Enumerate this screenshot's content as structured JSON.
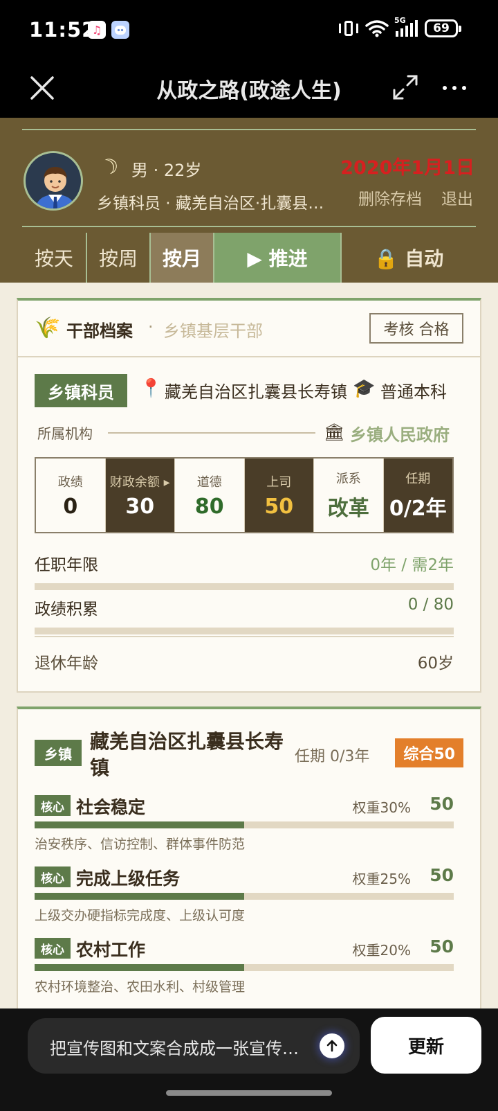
{
  "status": {
    "time": "11:52",
    "battery": "69",
    "network": "5G"
  },
  "titlebar": {
    "title": "从政之路(政途人生)"
  },
  "player": {
    "sex_age": "男 · 22岁",
    "post_location": "乡镇科员 · 藏羌自治区·扎囊县长寿镇",
    "date": "2020年1月1日",
    "delete_label": "删除存档",
    "exit_label": "退出"
  },
  "tabs": {
    "day": "按天",
    "week": "按周",
    "month": "按月",
    "advance": "▶ 推进",
    "auto": "🔒 自动",
    "selected": "month"
  },
  "profile": {
    "title": "干部档案",
    "dot": "·",
    "subtitle": "乡镇基层干部",
    "assessment": "考核 合格",
    "rank": "乡镇科员",
    "location": "藏羌自治区扎囊县长寿镇",
    "education": "普通本科",
    "org_label": "所属机构",
    "org_name": "乡镇人民政府",
    "stats": [
      {
        "label": "政绩",
        "value": "0",
        "color": "#2a2214",
        "dark": false
      },
      {
        "label": "财政余额 ▸",
        "value": "30",
        "color": "#ffffff",
        "dark": true
      },
      {
        "label": "道德",
        "value": "80",
        "color": "#2f6b2a",
        "dark": false
      },
      {
        "label": "上司",
        "value": "50",
        "color": "#f2c040",
        "dark": true
      },
      {
        "label": "派系",
        "value": "改革",
        "color": "#4d6e3c",
        "dark": false
      },
      {
        "label": "任期",
        "value": "0/2年",
        "color": "#ffffff",
        "dark": true
      }
    ],
    "tenure_label": "任职年限",
    "tenure_value": "0年 / 需2年",
    "tenure_progress": 0,
    "merit_label": "政绩积累",
    "merit_value": "0 / 80",
    "merit_progress": 0,
    "retire_label": "退休年龄",
    "retire_value": "60岁"
  },
  "town": {
    "badge": "乡镇",
    "name": "藏羌自治区扎囊县长寿镇",
    "term": "任期 0/3年",
    "score": "综合50",
    "kpis": [
      {
        "core": "核心",
        "name": "社会稳定",
        "weight": "权重30%",
        "score": "50",
        "progress": 0.5,
        "desc": "治安秩序、信访控制、群体事件防范"
      },
      {
        "core": "核心",
        "name": "完成上级任务",
        "weight": "权重25%",
        "score": "50",
        "progress": 0.5,
        "desc": "上级交办硬指标完成度、上级认可度"
      },
      {
        "core": "核心",
        "name": "农村工作",
        "weight": "权重20%",
        "score": "50",
        "progress": 0.5,
        "desc": "农村环境整治、农田水利、村级管理"
      }
    ]
  },
  "composer": {
    "text": "把宣传图和文案合成成一张宣传海报",
    "update_label": "更新"
  },
  "colors": {
    "header_bg": "#6b5a33",
    "accent_green": "#5d7a49",
    "date_red": "#d62020",
    "score_orange": "#e37f2b"
  }
}
